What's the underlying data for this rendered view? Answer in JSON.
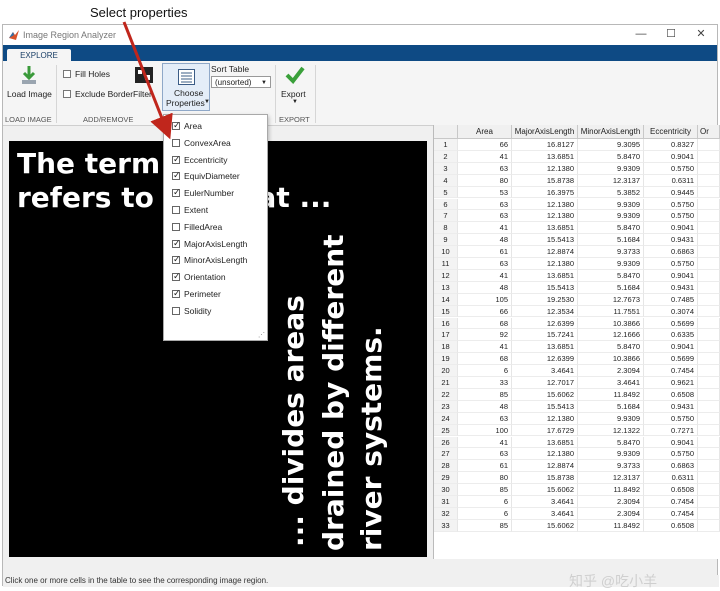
{
  "callout": "Select properties",
  "window": {
    "title": "Image Region Analyzer",
    "controls": {
      "minimize": "—",
      "maximize": "☐",
      "close": "✕"
    }
  },
  "ribbon": {
    "tab": "EXPLORE",
    "load_image": "Load Image",
    "fill_holes": "Fill Holes",
    "exclude_border": "Exclude Border",
    "filter": "Filter",
    "choose_properties_1": "Choose",
    "choose_properties_2": "Properties",
    "sort_table": "Sort Table",
    "sort_value": "(unsorted)",
    "export": "Export",
    "groups": {
      "load_image": "LOAD IMAGE",
      "add_remove": "ADD/REMOVE",
      "export": "EXPORT"
    }
  },
  "image_text": {
    "line1": "The term  ...ned",
    "line2": "refers to a...  that ...",
    "vertical1": "... divides areas",
    "vertical2": "drained by different",
    "vertical3": "river systems."
  },
  "properties": [
    {
      "label": "Area",
      "checked": true
    },
    {
      "label": "ConvexArea",
      "checked": false
    },
    {
      "label": "Eccentricity",
      "checked": true
    },
    {
      "label": "EquivDiameter",
      "checked": true
    },
    {
      "label": "EulerNumber",
      "checked": true
    },
    {
      "label": "Extent",
      "checked": false
    },
    {
      "label": "FilledArea",
      "checked": false
    },
    {
      "label": "MajorAxisLength",
      "checked": true
    },
    {
      "label": "MinorAxisLength",
      "checked": true
    },
    {
      "label": "Orientation",
      "checked": true
    },
    {
      "label": "Perimeter",
      "checked": true
    },
    {
      "label": "Solidity",
      "checked": false
    }
  ],
  "table": {
    "columns": [
      "Area",
      "MajorAxisLength",
      "MinorAxisLength",
      "Eccentricity",
      "Or"
    ],
    "rows": [
      [
        "1",
        "66",
        "16.8127",
        "9.3095",
        "0.8327"
      ],
      [
        "2",
        "41",
        "13.6851",
        "5.8470",
        "0.9041"
      ],
      [
        "3",
        "63",
        "12.1380",
        "9.9309",
        "0.5750"
      ],
      [
        "4",
        "80",
        "15.8738",
        "12.3137",
        "0.6311"
      ],
      [
        "5",
        "53",
        "16.3975",
        "5.3852",
        "0.9445"
      ],
      [
        "6",
        "63",
        "12.1380",
        "9.9309",
        "0.5750"
      ],
      [
        "7",
        "63",
        "12.1380",
        "9.9309",
        "0.5750"
      ],
      [
        "8",
        "41",
        "13.6851",
        "5.8470",
        "0.9041"
      ],
      [
        "9",
        "48",
        "15.5413",
        "5.1684",
        "0.9431"
      ],
      [
        "10",
        "61",
        "12.8874",
        "9.3733",
        "0.6863"
      ],
      [
        "11",
        "63",
        "12.1380",
        "9.9309",
        "0.5750"
      ],
      [
        "12",
        "41",
        "13.6851",
        "5.8470",
        "0.9041"
      ],
      [
        "13",
        "48",
        "15.5413",
        "5.1684",
        "0.9431"
      ],
      [
        "14",
        "105",
        "19.2530",
        "12.7673",
        "0.7485"
      ],
      [
        "15",
        "66",
        "12.3534",
        "11.7551",
        "0.3074"
      ],
      [
        "16",
        "68",
        "12.6399",
        "10.3866",
        "0.5699"
      ],
      [
        "17",
        "92",
        "15.7241",
        "12.1666",
        "0.6335"
      ],
      [
        "18",
        "41",
        "13.6851",
        "5.8470",
        "0.9041"
      ],
      [
        "19",
        "68",
        "12.6399",
        "10.3866",
        "0.5699"
      ],
      [
        "20",
        "6",
        "3.4641",
        "2.3094",
        "0.7454"
      ],
      [
        "21",
        "33",
        "12.7017",
        "3.4641",
        "0.9621"
      ],
      [
        "22",
        "85",
        "15.6062",
        "11.8492",
        "0.6508"
      ],
      [
        "23",
        "48",
        "15.5413",
        "5.1684",
        "0.9431"
      ],
      [
        "24",
        "63",
        "12.1380",
        "9.9309",
        "0.5750"
      ],
      [
        "25",
        "100",
        "17.6729",
        "12.1322",
        "0.7271"
      ],
      [
        "26",
        "41",
        "13.6851",
        "5.8470",
        "0.9041"
      ],
      [
        "27",
        "63",
        "12.1380",
        "9.9309",
        "0.5750"
      ],
      [
        "28",
        "61",
        "12.8874",
        "9.3733",
        "0.6863"
      ],
      [
        "29",
        "80",
        "15.8738",
        "12.3137",
        "0.6311"
      ],
      [
        "30",
        "85",
        "15.6062",
        "11.8492",
        "0.6508"
      ],
      [
        "31",
        "6",
        "3.4641",
        "2.3094",
        "0.7454"
      ],
      [
        "32",
        "6",
        "3.4641",
        "2.3094",
        "0.7454"
      ],
      [
        "33",
        "85",
        "15.6062",
        "11.8492",
        "0.6508"
      ]
    ]
  },
  "status": "Click one or more cells in the table to see the corresponding image region.",
  "watermark": "知乎 @吃小羊",
  "colors": {
    "ribbon_bar": "#0e4a84",
    "arrow": "#c0261c",
    "export_check": "#3aa03a"
  }
}
